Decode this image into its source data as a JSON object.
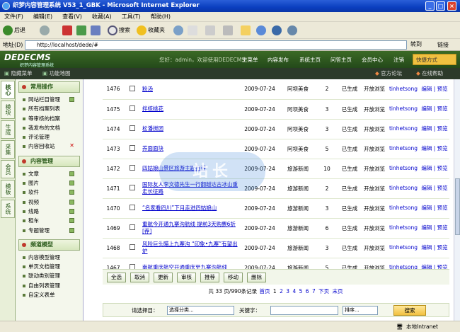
{
  "window": {
    "title": "织梦内容管理系统 V53_1_GBK - Microsoft Internet Explorer"
  },
  "menu": [
    "文件(F)",
    "编辑(E)",
    "查看(V)",
    "收藏(A)",
    "工具(T)",
    "帮助(H)"
  ],
  "toolbar": {
    "back": "后退",
    "search": "搜索",
    "favorites": "收藏夹"
  },
  "address": {
    "label": "地址(D)",
    "url": "http://localhost/dede/#",
    "go": "转到",
    "links": "链接"
  },
  "header": {
    "logo": "DEDECMS",
    "logo_sub": "织梦内容管理系统",
    "welcome": "您好：admin，欢迎使用DEDECMS！",
    "nav": [
      "主菜单",
      "内容发布",
      "系统主页",
      "问答主页",
      "会员中心",
      "注销"
    ],
    "quick": "快捷方式"
  },
  "subbar": {
    "hide_menu": "隐藏菜单",
    "site_map": "功能地图",
    "forum": "官方论坛",
    "help": "在线帮助"
  },
  "side_tabs": [
    "核心",
    "模块",
    "生成",
    "采集",
    "会员",
    "模板",
    "系统"
  ],
  "side_menu": {
    "section1": "常用操作",
    "items1": [
      "网站栏目管理",
      "所有档案列表",
      "等审核的档案",
      "我发布的文档",
      "评论管理",
      "内容回收站"
    ],
    "section2": "内容管理",
    "items2": [
      "文章",
      "图片",
      "软件",
      "视频",
      "线路",
      "租车",
      "专题管理"
    ],
    "section3": "频道模型",
    "items3": [
      "内容模型管理",
      "单页文档管理",
      "联动类别管理",
      "自由列表管理",
      "自定义表单"
    ]
  },
  "rows": [
    {
      "id": "1476",
      "title": "粉汤",
      "date": "2009-07-24",
      "cat": "阿坝美食",
      "clicks": "2",
      "status": "已生成",
      "browse": "开放浏览",
      "author": "tinhetsong",
      "ops": "编辑 | 预览"
    },
    {
      "id": "1475",
      "title": "拌核桃花",
      "date": "2009-07-24",
      "cat": "阿坝美食",
      "clicks": "3",
      "status": "已生成",
      "browse": "开放浏览",
      "author": "tinhetsong",
      "ops": "编辑 | 预览"
    },
    {
      "id": "1474",
      "title": "松潘搅团",
      "date": "2009-07-24",
      "cat": "阿坝美食",
      "clicks": "3",
      "status": "已生成",
      "browse": "开放浏览",
      "author": "tinhetsong",
      "ops": "编辑 | 预览"
    },
    {
      "id": "1473",
      "title": "荞面面块",
      "date": "2009-07-24",
      "cat": "阿坝美食",
      "clicks": "5",
      "status": "已生成",
      "browse": "开放浏览",
      "author": "tinhetsong",
      "ops": "编辑 | 预览"
    },
    {
      "id": "1472",
      "title": "四姑娘山景区旅游主题推荐",
      "date": "2009-07-24",
      "cat": "旅游新闻",
      "clicks": "10",
      "status": "已生成",
      "browse": "开放浏览",
      "author": "tinhetsong",
      "ops": "编辑 | 预览"
    },
    {
      "id": "1471",
      "title": "国际友人李文德先生一行翻越达古冰山重走长征路",
      "date": "2009-07-24",
      "cat": "旅游新闻",
      "clicks": "2",
      "status": "已生成",
      "browse": "开放浏览",
      "author": "tinhetsong",
      "ops": "编辑 | 预览"
    },
    {
      "id": "1470",
      "title": "“名家看四川”下月走进四姑娘山",
      "date": "2009-07-24",
      "cat": "旅游新闻",
      "clicks": "3",
      "status": "已生成",
      "browse": "开放浏览",
      "author": "tinhetsong",
      "ops": "编辑 | 预览"
    },
    {
      "id": "1469",
      "title": "重航今开通九寨沟航线 提前3天购票6折 [荐]",
      "date": "2009-07-24",
      "cat": "旅游新闻",
      "clicks": "6",
      "status": "已生成",
      "browse": "开放浏览",
      "author": "tinhetsong",
      "ops": "编辑 | 预览"
    },
    {
      "id": "1468",
      "title": "风险巨头瞄上九寨沟 “印象•九寨”有望出炉",
      "date": "2009-07-24",
      "cat": "旅游新闻",
      "clicks": "3",
      "status": "已生成",
      "browse": "开放浏览",
      "author": "tinhetsong",
      "ops": "编辑 | 预览"
    },
    {
      "id": "1467",
      "title": "南航重庆航空开通重庆至九寨沟航线",
      "date": "2009-07-24",
      "cat": "旅游新闻",
      "clicks": "5",
      "status": "已生成",
      "browse": "开放浏览",
      "author": "tinhetsong",
      "ops": "编辑 | 预览"
    }
  ],
  "actions": [
    "全选",
    "取消",
    "更新",
    "审核",
    "推荐",
    "移动",
    "删除"
  ],
  "pager": {
    "summary": "共 33 页/990条记录",
    "first": "首页",
    "pages": [
      "1",
      "2",
      "3",
      "4",
      "5",
      "6",
      "7"
    ],
    "next": "下页",
    "last": "末页"
  },
  "search": {
    "label": "请选择目：",
    "category": "选择分类...",
    "keyword_label": "关键字：",
    "sort": "排序...",
    "button": "搜索"
  },
  "status": {
    "zone": "本地Intranet"
  },
  "watermark": "站长"
}
